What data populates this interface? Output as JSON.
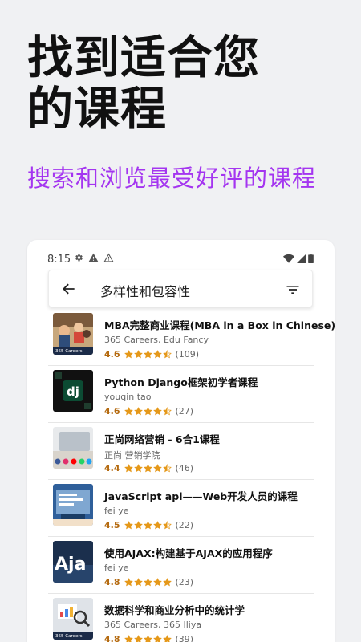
{
  "promo": {
    "headline_line1": "找到适合您",
    "headline_line2": "的课程",
    "subheadline": "搜索和浏览最受好评的课程"
  },
  "status_bar": {
    "time": "8:15",
    "icons": [
      "gear-icon",
      "alert-icon",
      "warning-outline-icon",
      "wifi-icon",
      "signal-icon",
      "battery-icon"
    ]
  },
  "search": {
    "query": "多样性和包容性",
    "back_icon": "arrow-left-icon",
    "filter_icon": "filter-icon"
  },
  "colors": {
    "accent": "#a435f0",
    "rating": "#b4690e",
    "star": "#e59819"
  },
  "courses": [
    {
      "title": "MBA完整商业课程(MBA in a Box in Chinese)",
      "author": "365 Careers, Edu Fancy",
      "rating": "4.6",
      "rating_value": 4.6,
      "reviews": "(109)",
      "thumb": "mba"
    },
    {
      "title": "Python Django框架初学者课程",
      "author": "youqin tao",
      "rating": "4.6",
      "rating_value": 4.6,
      "reviews": "(27)",
      "thumb": "django"
    },
    {
      "title": "正尚网络营销 - 6合1课程",
      "author": "正尚 营销学院",
      "rating": "4.4",
      "rating_value": 4.4,
      "reviews": "(46)",
      "thumb": "marketing"
    },
    {
      "title": "JavaScript api——Web开发人员的课程",
      "author": "fei ye",
      "rating": "4.5",
      "rating_value": 4.5,
      "reviews": "(22)",
      "thumb": "javascript"
    },
    {
      "title": "使用AJAX:构建基于AJAX的应用程序",
      "author": "fei ye",
      "rating": "4.8",
      "rating_value": 4.8,
      "reviews": "(23)",
      "thumb": "ajax"
    },
    {
      "title": "数据科学和商业分析中的统计学",
      "author": "365 Careers, 365 Iliya",
      "rating": "4.8",
      "rating_value": 4.8,
      "reviews": "(39)",
      "thumb": "stats"
    }
  ]
}
